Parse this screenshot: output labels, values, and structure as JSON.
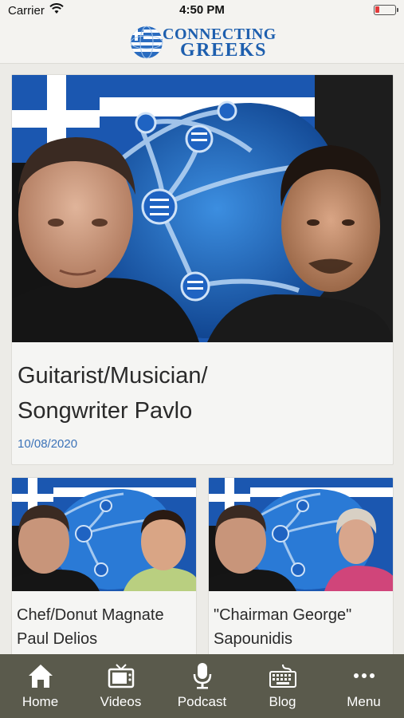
{
  "status_bar": {
    "carrier": "Carrier",
    "time": "4:50 PM",
    "battery_level": 0.2,
    "battery_color": "#e23a3a"
  },
  "header": {
    "logo_line1": "CONNECTING",
    "logo_line2": "GREEKS",
    "brand_color": "#1e5fae"
  },
  "featured": {
    "title_line1": "Guitarist/Musician/",
    "title_line2": "Songwriter Pavlo",
    "date": "10/08/2020"
  },
  "cards": [
    {
      "title_line1": "Chef/Donut Magnate",
      "title_line2": "Paul Delios"
    },
    {
      "title_line1": "\"Chairman George\"",
      "title_line2": "Sapounidis"
    }
  ],
  "tabs": [
    {
      "label": "Home",
      "icon": "home-icon"
    },
    {
      "label": "Videos",
      "icon": "tv-icon"
    },
    {
      "label": "Podcast",
      "icon": "microphone-icon"
    },
    {
      "label": "Blog",
      "icon": "keyboard-icon"
    },
    {
      "label": "Menu",
      "icon": "more-dots-icon"
    }
  ],
  "colors": {
    "tabbar": "#5a5a4c",
    "date": "#3c73b8",
    "background": "#ecebe7"
  }
}
